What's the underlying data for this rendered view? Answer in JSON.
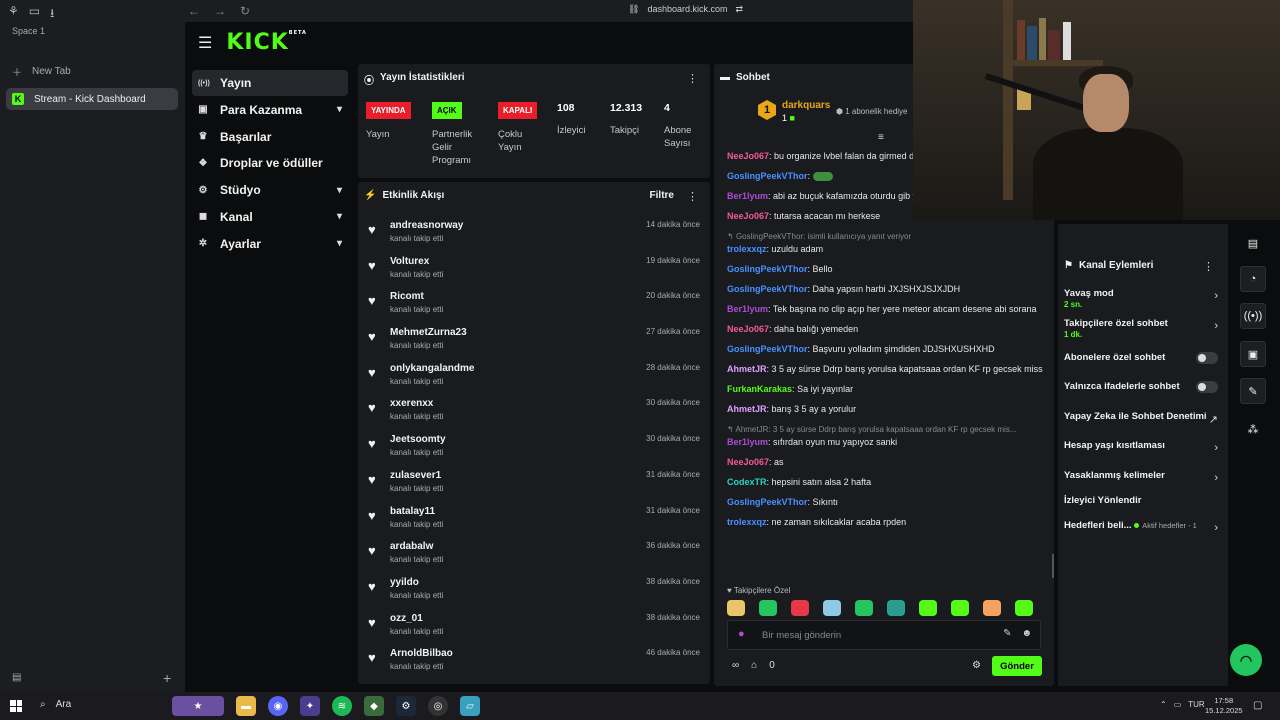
{
  "browser": {
    "space_label": "Space 1",
    "new_tab_label": "New Tab",
    "active_tab_title": "Stream - Kick Dashboard",
    "url": "dashboard.kick.com"
  },
  "header": {
    "logo": "KICK",
    "logo_badge": "BETA"
  },
  "nav": [
    {
      "label": "Yayın",
      "icon": "broadcast-icon",
      "chev": ""
    },
    {
      "label": "Para Kazanma",
      "icon": "money-icon",
      "chev": "▾"
    },
    {
      "label": "Başarılar",
      "icon": "trophy-icon",
      "chev": ""
    },
    {
      "label": "Droplar ve ödüller",
      "icon": "gift-icon",
      "chev": ""
    },
    {
      "label": "Stüdyo",
      "icon": "studio-icon",
      "chev": "▾"
    },
    {
      "label": "Kanal",
      "icon": "channel-icon",
      "chev": "▾"
    },
    {
      "label": "Ayarlar",
      "icon": "settings-icon",
      "chev": "▾"
    }
  ],
  "stats": {
    "title": "Yayın İstatistikleri",
    "live_badge": "YAYINDA",
    "live_label": "Yayın",
    "partner_badge": "AÇIK",
    "partner_label": "Partnerlik Gelir Programı",
    "multi_badge": "KAPALI",
    "multi_label": "Çoklu Yayın",
    "viewers": "108",
    "viewers_label": "İzleyici",
    "followers": "12.313",
    "followers_label": "Takipçi",
    "subs": "4",
    "subs_label": "Abone Sayısı"
  },
  "feed": {
    "title": "Etkinlik Akışı",
    "filter_label": "Filtre",
    "items": [
      {
        "name": "andreasnorway",
        "action": "kanalı takip etti",
        "time": "14 dakika önce"
      },
      {
        "name": "Volturex",
        "action": "kanalı takip etti",
        "time": "19 dakika önce"
      },
      {
        "name": "Ricomt",
        "action": "kanalı takip etti",
        "time": "20 dakika önce"
      },
      {
        "name": "MehmetZurna23",
        "action": "kanalı takip etti",
        "time": "27 dakika önce"
      },
      {
        "name": "onlykangalandme",
        "action": "kanalı takip etti",
        "time": "28 dakika önce"
      },
      {
        "name": "xxerenxx",
        "action": "kanalı takip etti",
        "time": "30 dakika önce"
      },
      {
        "name": "Jeetsoomty",
        "action": "kanalı takip etti",
        "time": "30 dakika önce"
      },
      {
        "name": "zulasever1",
        "action": "kanalı takip etti",
        "time": "31 dakika önce"
      },
      {
        "name": "batalay11",
        "action": "kanalı takip etti",
        "time": "31 dakika önce"
      },
      {
        "name": "ardabalw",
        "action": "kanalı takip etti",
        "time": "36 dakika önce"
      },
      {
        "name": "yyildo",
        "action": "kanalı takip etti",
        "time": "38 dakika önce"
      },
      {
        "name": "ozz_01",
        "action": "kanalı takip etti",
        "time": "38 dakika önce"
      },
      {
        "name": "ArnoldBilbao",
        "action": "kanalı takip etti",
        "time": "46 dakika önce"
      }
    ]
  },
  "chat": {
    "title": "Sohbet",
    "pinned_user": "darkquars",
    "pinned_count": "1",
    "pinned_badge": "1",
    "pinned_gift": "1 abonelik hediye",
    "messages": [
      {
        "user": "NeeJo067",
        "color": "#f25a9a",
        "text": "bu organize lvbel falan da girmed dıyolardı"
      },
      {
        "user": "GoslingPeekVThor",
        "color": "#4a90ff",
        "text": ""
      },
      {
        "user": "Ber1lyum",
        "color": "#b04bd6",
        "text": "abi az buçuk kafamızda oturdu gib yeni geldim"
      },
      {
        "user": "NeeJo067",
        "color": "#f25a9a",
        "text": "tutarsa acacan mı herkese"
      },
      {
        "reply": "GoslingPeekVThor:  isimli kullanıcıya yanıt veriyor",
        "user": "trolexxqz",
        "color": "#4a90ff",
        "text": "uzuldu adam"
      },
      {
        "user": "GoslingPeekVThor",
        "color": "#4a90ff",
        "text": "Bello"
      },
      {
        "user": "GoslingPeekVThor",
        "color": "#4a90ff",
        "text": "Daha yapsın harbi JXJSHXJSJXJDH"
      },
      {
        "user": "Ber1lyum",
        "color": "#b04bd6",
        "text": "Tek başına no clip açıp her yere meteor atıcam desene abi sorana"
      },
      {
        "user": "NeeJo067",
        "color": "#f25a9a",
        "text": "daha balığı yemeden"
      },
      {
        "user": "GoslingPeekVThor",
        "color": "#4a90ff",
        "text": "Başvuru yolladım şimdiden JDJSHXUSHXHD"
      },
      {
        "user": "AhmetJR",
        "color": "#e0a0ff",
        "text": "3 5 ay sürse Ddrp barış yorulsa kapatsaaa ordan KF rp gecsek miss"
      },
      {
        "user": "FurkanKarakas",
        "color": "#53fc18",
        "text": "Sa iyi yayınlar"
      },
      {
        "user": "AhmetJR",
        "color": "#e0a0ff",
        "text": "barış 3 5 ay a yorulur"
      },
      {
        "reply": "AhmetJR: 3 5 ay sürse Ddrp barış yorulsa kapatsaaa ordan KF rp gecsek mis...",
        "user": "Ber1lyum",
        "color": "#b04bd6",
        "text": "sıfırdan oyun mu yapıyoz sanki"
      },
      {
        "user": "NeeJo067",
        "color": "#f25a9a",
        "text": "as"
      },
      {
        "user": "CodexTR",
        "color": "#2dd4bf",
        "text": "hepsini satın alsa 2 hafta"
      },
      {
        "user": "GoslingPeekVThor",
        "color": "#4a90ff",
        "text": "Sıkıntı"
      },
      {
        "user": "trolexxqz",
        "color": "#4a90ff",
        "text": "ne zaman sıkılcaklar acaba rpden"
      }
    ],
    "followers_only_label": "Takipçilere Özel",
    "input_placeholder": "Bir mesaj gönderin",
    "point_count": "0",
    "send_label": "Gönder",
    "emote_colors": [
      "#e9c46a",
      "#22c55e",
      "#e63946",
      "#8ecae6",
      "#22c55e",
      "#2a9d8f",
      "#53fc18",
      "#53fc18",
      "#f4a261",
      "#53fc18"
    ]
  },
  "channel_actions": {
    "title": "Kanal Eylemleri",
    "slow_mode": "Yavaş mod",
    "slow_mode_value": "2 sn.",
    "followers_chat": "Takipçilere özel sohbet",
    "followers_chat_value": "1 dk.",
    "subs_chat": "Abonelere özel sohbet",
    "emotes_chat": "Yalnızca ifadelerle sohbet",
    "ai_moderation": "Yapay Zeka ile Sohbet Denetimi",
    "account_age": "Hesap yaşı kısıtlaması",
    "banned_words": "Yasaklanmış kelimeler",
    "redirect_viewers": "İzleyici Yönlendir",
    "goals": "Hedefleri beli...",
    "goals_active": "Aktif hedefler - 1"
  },
  "taskbar": {
    "search_label": "Ara",
    "language": "TUR",
    "time": "17:58",
    "date": "15.12.2025"
  }
}
